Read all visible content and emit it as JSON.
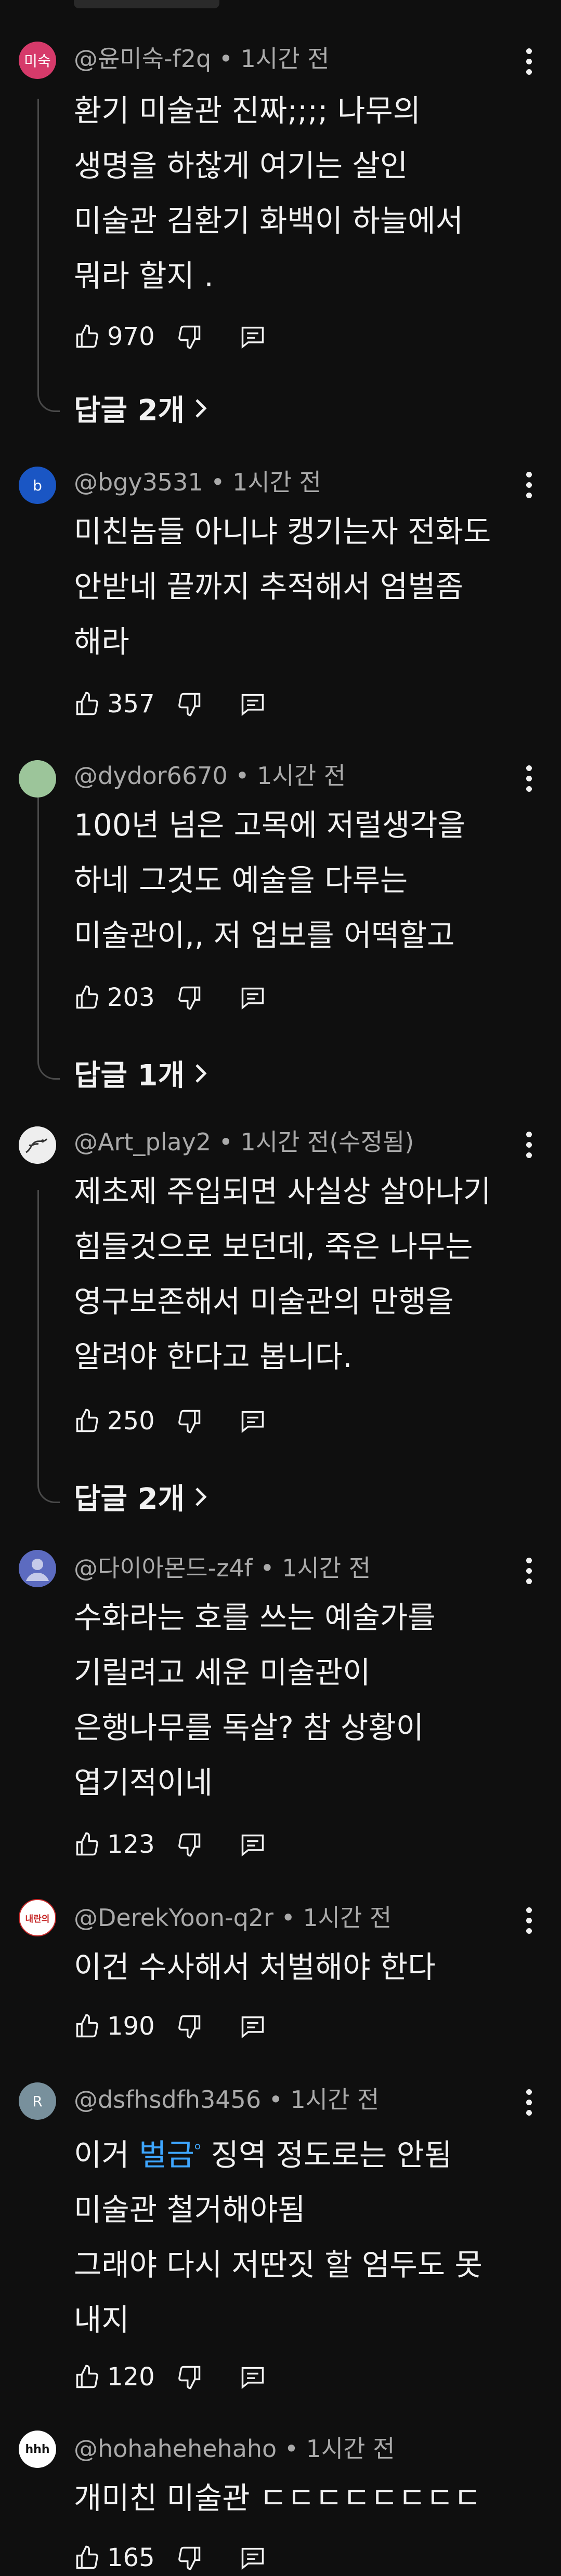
{
  "comments": [
    {
      "author": "@윤미숙-f2q",
      "time": "1시간 전",
      "avatar_text": "미숙",
      "avatar_color": "#d63a6a",
      "lines": [
        "환기 미술관 진짜;;;; 나무의",
        "생명을 하찮게 여기는 살인",
        "미술관 김환기 화백이 하늘에서",
        "뭐라 할지 ."
      ],
      "likes": "970",
      "replies": "답글 2개"
    },
    {
      "author": "@bgy3531",
      "time": "1시간 전",
      "avatar_text": "b",
      "avatar_color": "#1a56c4",
      "lines": [
        "미친놈들 아니냐 캥기는자 전화도",
        "안받네 끝까지 추적해서 엄벌좀",
        "해라"
      ],
      "likes": "357"
    },
    {
      "author": "@dydor6670",
      "time": "1시간 전",
      "avatar_text": "",
      "avatar_color": "#9cc59a",
      "lines": [
        "100년 넘은 고목에 저럴생각을",
        "하네 그것도 예술을 다루는",
        "미술관이,, 저 업보를 어떡할고"
      ],
      "likes": "203",
      "replies": "답글 1개"
    },
    {
      "author": "@Art_play2",
      "time": "1시간 전(수정됨)",
      "avatar_text": "",
      "avatar_color": "#e8e8e8",
      "lines": [
        "제초제 주입되면 사실상 살아나기",
        "힘들것으로 보던데, 죽은 나무는",
        "영구보존해서 미술관의 만행을",
        "알려야 한다고 봅니다."
      ],
      "likes": "250",
      "replies": "답글 2개"
    },
    {
      "author": "@다이아몬드-z4f",
      "time": "1시간 전",
      "avatar_text": "",
      "avatar_color": "#5c6bc0",
      "lines": [
        "수화라는 호를 쓰는 예술가를",
        "기릴려고 세운 미술관이",
        "은행나무를 독살? 참 상황이",
        "엽기적이네"
      ],
      "likes": "123"
    },
    {
      "author": "@DerekYoon-q2r",
      "time": "1시간 전",
      "avatar_text": "내란의",
      "avatar_color": "#ffffff",
      "lines": [
        "이건 수사해서 처벌해야 한다"
      ],
      "likes": "190"
    },
    {
      "author": "@dsfhsdfh3456",
      "time": "1시간 전",
      "avatar_text": "R",
      "avatar_color": "#78909c",
      "line1_prefix": "이거 ",
      "line1_link": "벌금",
      "line1_suffix": " 징역 정도로는 안됨",
      "lines_rest": [
        "미술관 철거해야됨",
        "그래야 다시 저딴짓 할 엄두도 못",
        "내지"
      ],
      "likes": "120"
    },
    {
      "author": "@hohahehehaho",
      "time": "1시간 전",
      "avatar_text": "hhh",
      "avatar_color": "#ffffff",
      "lines": [
        "개미친 미술관 ㄷㄷㄷㄷㄷㄷㄷㄷ"
      ],
      "likes": "165"
    }
  ],
  "icons": {
    "like": "thumb-up-icon",
    "dislike": "thumb-down-icon",
    "reply": "reply-icon",
    "more": "more-vert-icon",
    "chevron": "chevron-right-icon"
  },
  "colors": {
    "background": "#0f0f0f",
    "text": "#f1f1f1",
    "meta": "#aaaaaa",
    "link": "#3ea6ff"
  }
}
